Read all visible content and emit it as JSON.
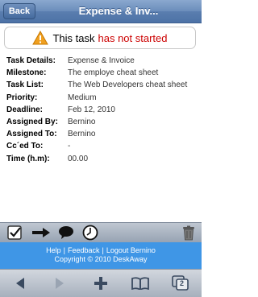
{
  "navbar": {
    "back_label": "Back",
    "title": "Expense & Inv..."
  },
  "status": {
    "prefix": "This task",
    "value": "has not started",
    "icon": "warning-icon",
    "value_color": "#cc0000"
  },
  "details": [
    {
      "label": "Task Details:",
      "value": "Expense & Invoice"
    },
    {
      "label": "Milestone:",
      "value": "The employe cheat sheet"
    },
    {
      "label": "Task List:",
      "value": "The Web Developers cheat sheet"
    },
    {
      "label": "Priority:",
      "value": "Medium"
    },
    {
      "label": "Deadline:",
      "value": "Feb 12, 2010"
    },
    {
      "label": "Assigned By:",
      "value": "Bernino"
    },
    {
      "label": "Assigned To:",
      "value": "Bernino"
    },
    {
      "label": "Cc´ed To:",
      "value": "-"
    },
    {
      "label": "Time (h.m):",
      "value": "00.00"
    }
  ],
  "toolbar": {
    "icons": [
      "checkbox-icon",
      "arrow-right-icon",
      "speech-bubble-icon",
      "clock-icon",
      "trash-icon"
    ]
  },
  "footer": {
    "link_help": "Help",
    "link_feedback": "Feedback",
    "link_logout": "Logout Bernino",
    "separator": "|",
    "copyright": "Copyright © 2010 DeskAway"
  },
  "browser": {
    "icons": [
      "back-arrow-icon",
      "forward-arrow-icon",
      "plus-icon",
      "bookmarks-icon",
      "pages-icon"
    ],
    "pages_count": "2"
  },
  "colors": {
    "navbar": "#5a7eaf",
    "footer": "#3f96e6",
    "warning": "#cc0000"
  }
}
